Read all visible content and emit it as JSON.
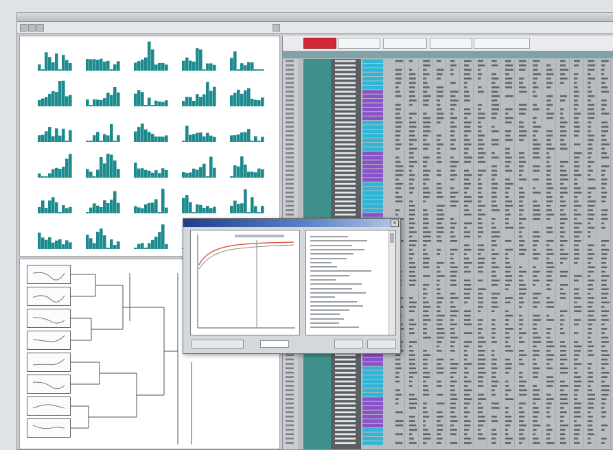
{
  "window": {
    "title": ""
  },
  "icons": {
    "close": "close-icon"
  },
  "colors": {
    "histogram_bar": "#1d8a8e",
    "grid_background": "#b9bdc2",
    "grid_cell": "#cfd2d5",
    "grid_value": "#5f6469",
    "id_column": "#3f8f8a",
    "name_column": "#5a5f64",
    "cyan_cell": "#2fb6d6",
    "purple_cell": "#8a52c8",
    "active_tab": "#d2283a",
    "dialog_title": "#1f3f8c",
    "dendrogram_line": "#4b5056",
    "curve": "#e15a4a"
  }
}
